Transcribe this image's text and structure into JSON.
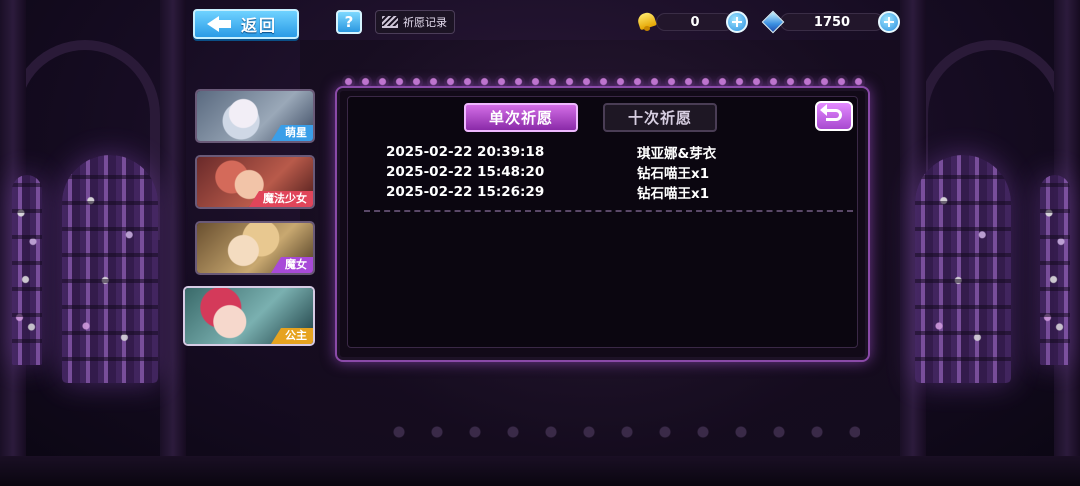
{
  "topbar": {
    "back_label": "返回",
    "help_label": "?",
    "record_label": "祈愿记录",
    "currency_bell": "0",
    "currency_gem": "1750"
  },
  "characters": [
    {
      "label": "萌星",
      "tag_color": "#3a9ee8"
    },
    {
      "label": "魔法少女",
      "tag_color": "#e0455a"
    },
    {
      "label": "魔女",
      "tag_color": "#a84ad8"
    },
    {
      "label": "公主",
      "tag_color": "#e6a320"
    }
  ],
  "panel": {
    "tab_single": "单次祈愿",
    "tab_ten": "十次祈愿",
    "records": [
      {
        "time": "2025-02-22 20:39:18",
        "item": "琪亚娜&芽衣"
      },
      {
        "time": "2025-02-22 15:48:20",
        "item": "钻石喵王x1"
      },
      {
        "time": "2025-02-22 15:26:29",
        "item": "钻石喵王x1"
      }
    ]
  },
  "colors": {
    "accent_purple": "#a84ad0",
    "accent_blue": "#2a9be6"
  }
}
